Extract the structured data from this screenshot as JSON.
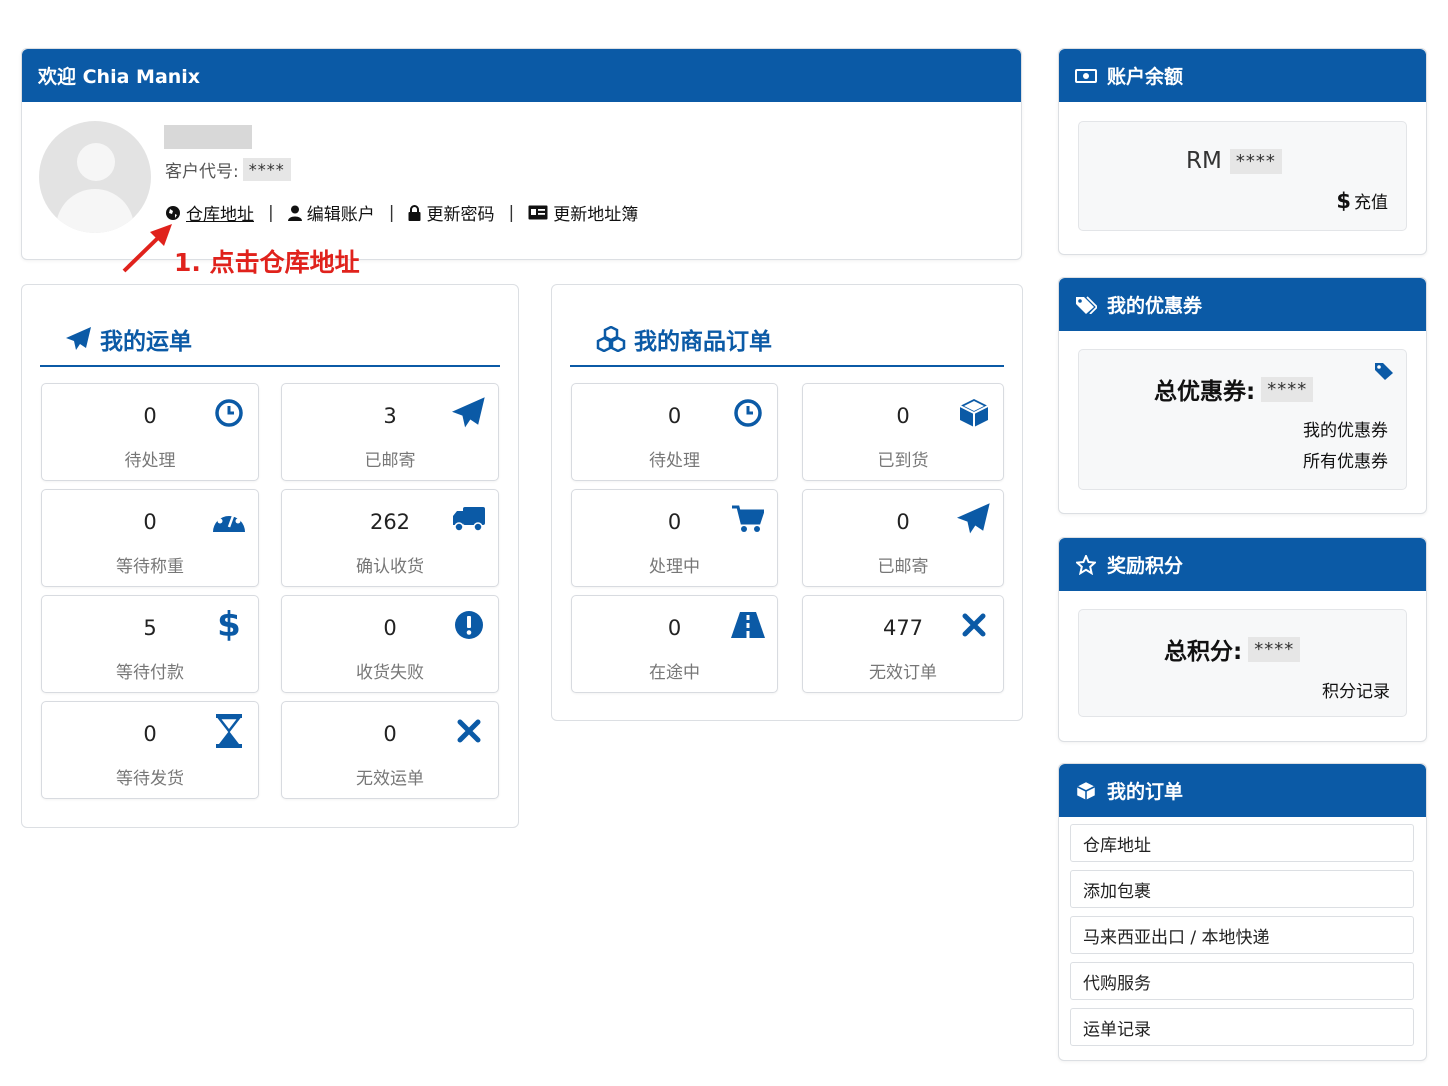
{
  "welcome": {
    "title": "欢迎 Chia Manix",
    "customer_code_label": "客户代号:",
    "customer_code_value": "****",
    "links": {
      "warehouse": "仓库地址",
      "edit_account": "编辑账户",
      "update_password": "更新密码",
      "address_book": "更新地址簿"
    },
    "separator": "|"
  },
  "annotation": "1. 点击仓库地址",
  "shipments": {
    "title": "我的运单",
    "cards": [
      {
        "value": "0",
        "label": "待处理",
        "icon": "clock-icon"
      },
      {
        "value": "3",
        "label": "已邮寄",
        "icon": "paper-plane-icon"
      },
      {
        "value": "0",
        "label": "等待称重",
        "icon": "gauge-icon"
      },
      {
        "value": "262",
        "label": "确认收货",
        "icon": "truck-icon"
      },
      {
        "value": "5",
        "label": "等待付款",
        "icon": "dollar-icon"
      },
      {
        "value": "0",
        "label": "收货失败",
        "icon": "exclamation-icon"
      },
      {
        "value": "0",
        "label": "等待发货",
        "icon": "hourglass-icon"
      },
      {
        "value": "0",
        "label": "无效运单",
        "icon": "close-icon"
      }
    ]
  },
  "orders": {
    "title": "我的商品订单",
    "cards": [
      {
        "value": "0",
        "label": "待处理",
        "icon": "clock-icon"
      },
      {
        "value": "0",
        "label": "已到货",
        "icon": "box-icon"
      },
      {
        "value": "0",
        "label": "处理中",
        "icon": "cart-icon"
      },
      {
        "value": "0",
        "label": "已邮寄",
        "icon": "paper-plane-icon"
      },
      {
        "value": "0",
        "label": "在途中",
        "icon": "road-icon"
      },
      {
        "value": "477",
        "label": "无效订单",
        "icon": "close-icon"
      }
    ]
  },
  "balance": {
    "title": "账户余额",
    "currency": "RM",
    "amount": "****",
    "topup_symbol": "$",
    "topup_label": "充值"
  },
  "coupons": {
    "title": "我的优惠券",
    "total_label": "总优惠券:",
    "total_value": "****",
    "my_coupons": "我的优惠券",
    "all_coupons": "所有优惠券"
  },
  "points": {
    "title": "奖励积分",
    "total_label": "总积分:",
    "total_value": "****",
    "history": "积分记录"
  },
  "myorders": {
    "title": "我的订单",
    "items": [
      "仓库地址",
      "添加包裹",
      "马来西亚出口 / 本地快递",
      "代购服务",
      "运单记录"
    ]
  },
  "colors": {
    "brand_blue": "#0b5aa6",
    "annotation_red": "#e0221c"
  }
}
